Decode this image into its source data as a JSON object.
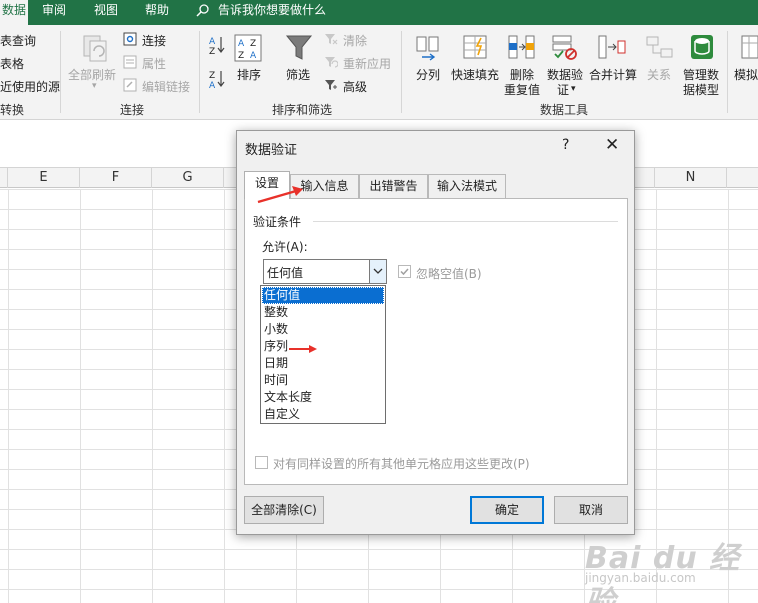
{
  "ribbon_tabs": {
    "data": "数据",
    "review": "审阅",
    "view": "视图",
    "help": "帮助",
    "tell_me": "告诉我你想要做什么"
  },
  "ribbon": {
    "left_partial": [
      "表查询",
      "表格",
      "近使用的源",
      "转换"
    ],
    "connections": {
      "refresh_all": "全部刷新",
      "connections": "连接",
      "properties": "属性",
      "edit_links": "编辑链接",
      "group": "连接"
    },
    "sort_filter": {
      "sort": "排序",
      "filter": "筛选",
      "clear": "清除",
      "reapply": "重新应用",
      "advanced": "高级",
      "group": "排序和筛选",
      "az": "A↓Z",
      "za": "Z↓A"
    },
    "data_tools": {
      "text_to_columns": "分列",
      "flash_fill": "快速填充",
      "remove_duplicates_1": "删除",
      "remove_duplicates_2": "重复值",
      "data_validation_1": "数据验",
      "data_validation_2": "证",
      "consolidate": "合并计算",
      "relationships": "关系",
      "manage_model_1": "管理数",
      "manage_model_2": "据模型",
      "group": "数据工具"
    },
    "what_if_partial": "模拟"
  },
  "columns": [
    "E",
    "F",
    "G",
    "N"
  ],
  "dialog": {
    "title": "数据验证",
    "help": "?",
    "close": "✕",
    "tabs": [
      "设置",
      "输入信息",
      "出错警告",
      "输入法模式"
    ],
    "section": "验证条件",
    "allow_label": "允许(A):",
    "allow_value": "任何值",
    "ignore_blank": "忽略空值(B)",
    "dropdown_items": [
      "任何值",
      "整数",
      "小数",
      "序列",
      "日期",
      "时间",
      "文本长度",
      "自定义"
    ],
    "selected_index": 0,
    "apply_all": "对有同样设置的所有其他单元格应用这些更改(P)",
    "clear_all": "全部清除(C)",
    "ok": "确定",
    "cancel": "取消"
  },
  "watermark": {
    "main": "Bai du 经验",
    "sub": "jingyan.baidu.com"
  },
  "colors": {
    "excel_green": "#217346",
    "selection_blue": "#0a6ed1",
    "annotation_red": "#e8312a"
  }
}
